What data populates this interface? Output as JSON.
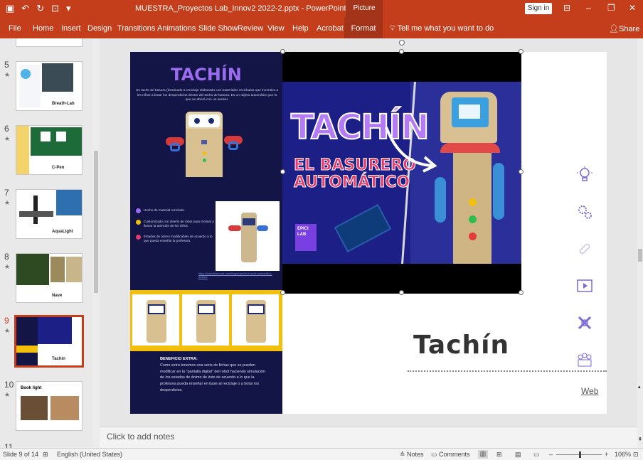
{
  "titlebar": {
    "doc_title": "MUESTRA_Proyectos Lab_Innov2 2022-2.pptx  -  PowerPoint",
    "context_tab": "Picture Tools",
    "signin": "Sign in"
  },
  "ribbon": {
    "tabs": [
      "File",
      "Home",
      "Insert",
      "Design",
      "Transitions",
      "Animations",
      "Slide Show",
      "Review",
      "View",
      "Help",
      "Acrobat"
    ],
    "format_tab": "Format",
    "tell_me": "Tell me what you want to do",
    "share": "Share"
  },
  "thumbnails": [
    {
      "num": "5",
      "caption": "Breath-Lab"
    },
    {
      "num": "6",
      "caption": "C-Pen"
    },
    {
      "num": "7",
      "caption": "AquaLight"
    },
    {
      "num": "8",
      "caption": "Nave"
    },
    {
      "num": "9",
      "caption": "Tachin"
    },
    {
      "num": "10",
      "caption": "Book light"
    },
    {
      "num": "11",
      "caption": ""
    }
  ],
  "slide": {
    "left_title": "TACHÍN",
    "left_desc": "Un tacho de basura (destinado a reciclaje elaborado con materiales reciclados que incentiva a los niños a botar los desperdicios dentro del tacho de basura. Es un objeto  automático por lo que se abrirá con un sensor.",
    "bullets": [
      "Hecho de material reciclado.",
      "Customizado con diseño de robot para motivar y llamar la atención de los niños.",
      "Estados de ánimo modificables de acuerdo a lo que pueda enseñar la profesora."
    ],
    "link_text": "https://www.tinkercad.com/things/hjwx5s1t-tachin-automatico-arduino",
    "benefit_title": "BENEFICIO EXTRA:",
    "benefit_body": "Como extra tenemos una serie de fichas que se pueden modificar en la \"pantalla digital\" del robot haciendo simulación de los estados de ánimo de éste de acuerdo a lo que la profesora pueda enseñar en base al reciclaje o a botar los desperdicios.",
    "banner_line1": "TACHÍN",
    "banner_line2": "EL BASURERO",
    "banner_line3": "AUTOMÁTICO",
    "banner_logo": "EPICI LAB",
    "right_title": "Tachín",
    "web_link": "Web",
    "icons": [
      "lightbulb-icon",
      "gears-icon",
      "bandage-icon",
      "video-icon",
      "puzzle-icon",
      "people-icon"
    ]
  },
  "notes": {
    "placeholder": "Click to add notes"
  },
  "status": {
    "slide_info": "Slide 9 of 14",
    "language": "English (United States)",
    "notes": "Notes",
    "comments": "Comments",
    "zoom": "106%"
  },
  "colors": {
    "accent": "#c43e1c",
    "slide_navy": "#121546",
    "tachin_purple": "#9c6cf0",
    "banner_pink": "#e23b6c",
    "strip_yellow": "#f2c00c"
  }
}
